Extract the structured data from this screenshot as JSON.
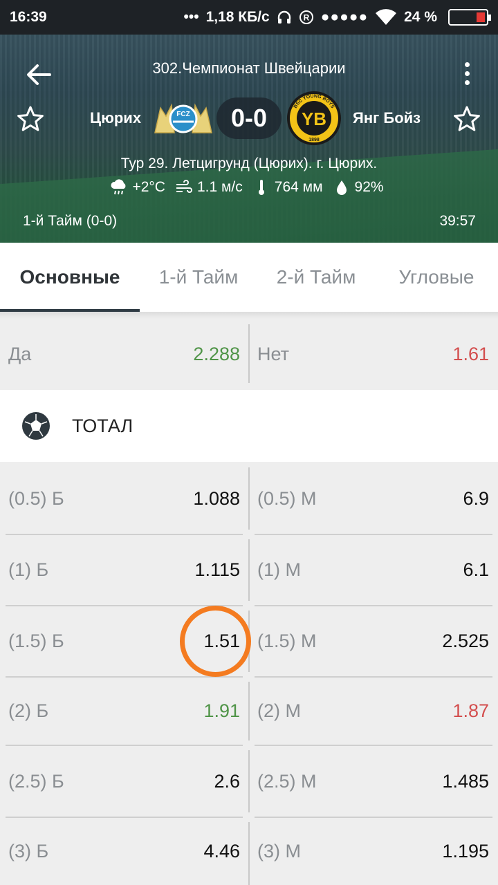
{
  "status_bar": {
    "time": "16:39",
    "speed": "1,18 КБ/с",
    "battery": "24 %",
    "icons": [
      "ellipsis-icon",
      "headphones-icon",
      "registered-icon",
      "signal-dots-icon",
      "wifi-icon",
      "battery-icon"
    ]
  },
  "match": {
    "league": "302.Чемпионат Швейцарии",
    "home_team": "Цюрих",
    "away_team": "Янг Бойз",
    "home_crest_text": "FCZ",
    "away_crest_text": "YB",
    "away_crest_ring": "BSC YOUNG BOYS",
    "away_crest_year": "1898",
    "score": "0-0",
    "venue": "Тур 29. Летцигрунд (Цюрих). г. Цюрих.",
    "weather": {
      "temperature": "+2°C",
      "wind": "1.1 м/с",
      "pressure": "764 мм",
      "humidity": "92%"
    },
    "period": "1-й  Тайм (0-0)",
    "clock": "39:57"
  },
  "tabs": [
    {
      "label": "Основные",
      "active": true
    },
    {
      "label": "1-й  Тайм",
      "active": false
    },
    {
      "label": "2-й  Тайм",
      "active": false
    },
    {
      "label": "Угловые",
      "active": false
    }
  ],
  "yes_no": {
    "yes_label": "Да",
    "yes_value": "2.288",
    "no_label": "Нет",
    "no_value": "1.61"
  },
  "total": {
    "title": "ТОТАЛ",
    "rows": [
      {
        "over_label": "(0.5) Б",
        "over_value": "1.088",
        "under_label": "(0.5) М",
        "under_value": "6.9"
      },
      {
        "over_label": "(1) Б",
        "over_value": "1.115",
        "under_label": "(1) М",
        "under_value": "6.1"
      },
      {
        "over_label": "(1.5) Б",
        "over_value": "1.51",
        "under_label": "(1.5) М",
        "under_value": "2.525"
      },
      {
        "over_label": "(2) Б",
        "over_value": "1.91",
        "under_label": "(2) М",
        "under_value": "1.87"
      },
      {
        "over_label": "(2.5) Б",
        "over_value": "2.6",
        "under_label": "(2.5) М",
        "under_value": "1.485"
      },
      {
        "over_label": "(3) Б",
        "over_value": "4.46",
        "under_label": "(3) М",
        "under_value": "1.195"
      }
    ]
  },
  "colors": {
    "up": "#4f9447",
    "down": "#d34e4e",
    "highlight_circle": "#f47b20"
  }
}
